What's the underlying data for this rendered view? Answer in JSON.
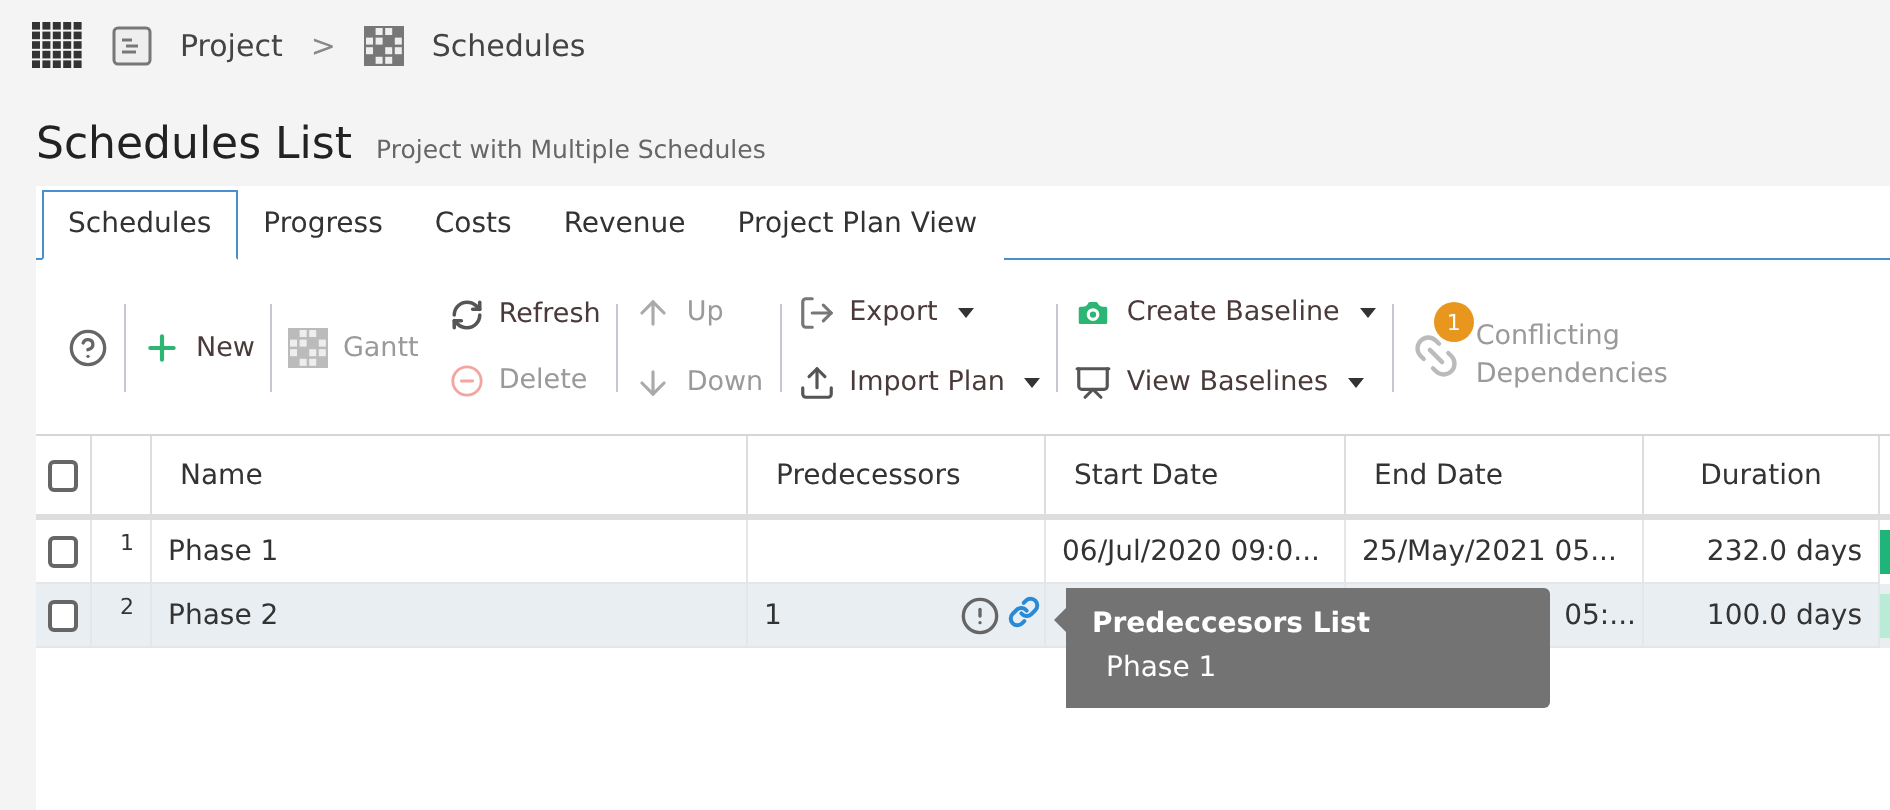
{
  "breadcrumb": [
    {
      "label": "Project"
    },
    {
      "label": "Schedules"
    }
  ],
  "breadcrumb_separator": ">",
  "page": {
    "title": "Schedules List",
    "subtitle": "Project with Multiple Schedules"
  },
  "tabs": [
    {
      "label": "Schedules",
      "selected": true
    },
    {
      "label": "Progress",
      "selected": false
    },
    {
      "label": "Costs",
      "selected": false
    },
    {
      "label": "Revenue",
      "selected": false
    },
    {
      "label": "Project Plan View",
      "selected": false
    }
  ],
  "toolbar": {
    "groups": [
      {
        "items": [
          {
            "disabled": false,
            "dropdown": false
          }
        ]
      },
      {
        "items": [
          {
            "label": "New",
            "disabled": false,
            "dropdown": false
          }
        ]
      },
      {
        "items": [
          {
            "label": "Gantt",
            "disabled": true,
            "dropdown": false
          }
        ]
      },
      {
        "items": [
          {
            "label": "Refresh",
            "disabled": false,
            "dropdown": false
          },
          {
            "label": "Delete",
            "disabled": true,
            "dropdown": false
          }
        ]
      },
      {
        "items": [
          {
            "label": "Up",
            "disabled": true,
            "dropdown": false
          },
          {
            "label": "Down",
            "disabled": true,
            "dropdown": false
          }
        ]
      },
      {
        "items": [
          {
            "label": "Export",
            "disabled": false,
            "dropdown": true
          },
          {
            "label": "Import Plan",
            "disabled": false,
            "dropdown": true
          }
        ]
      },
      {
        "items": [
          {
            "label": "Create Baseline",
            "disabled": false,
            "dropdown": true
          },
          {
            "label": "View Baselines",
            "disabled": false,
            "dropdown": true
          }
        ]
      },
      {
        "items": [
          {
            "label": "Conflicting Dependencies",
            "disabled": true,
            "dropdown": false,
            "badge": "1"
          }
        ]
      }
    ]
  },
  "table": {
    "header_checked": false,
    "columns": [
      "Name",
      "Predecessors",
      "Start Date",
      "End Date",
      "Duration"
    ],
    "rows": [
      {
        "number": "1",
        "checked": false,
        "selected": false,
        "name": "Phase 1",
        "warning": false,
        "start": "06/Jul/2020 09:0...",
        "end": "25/May/2021 05...",
        "duration": "232.0 days",
        "color": "#1fb57a"
      },
      {
        "number": "2",
        "checked": false,
        "selected": true,
        "name": "Phase 2",
        "predecessors": "1",
        "warning": true,
        "end": "05:...",
        "duration": "100.0 days",
        "color": "#b8ecd6"
      }
    ]
  },
  "tooltip": {
    "title": "Predeccesors List",
    "items": [
      "Phase 1"
    ]
  }
}
